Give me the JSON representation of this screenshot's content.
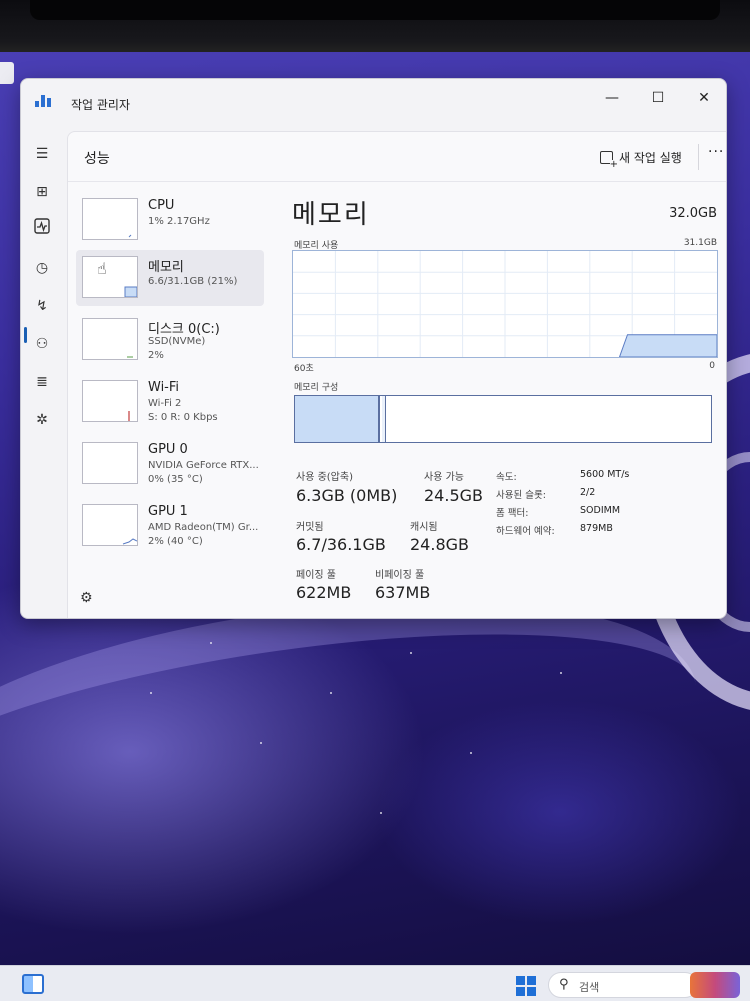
{
  "window": {
    "title": "작업 관리자",
    "minimize": "—",
    "maximize": "☐",
    "close": "✕"
  },
  "nav": {
    "icons": [
      "hamburger-icon",
      "processes-icon",
      "performance-icon",
      "app-history-icon",
      "startup-icon",
      "users-icon",
      "details-icon",
      "services-icon",
      "settings-icon"
    ],
    "active": "performance"
  },
  "header": {
    "page_title": "성능",
    "run_task_label": "새 작업 실행",
    "more": "···"
  },
  "resources": [
    {
      "name": "CPU",
      "sub1": "1% 2.17GHz",
      "sub2": ""
    },
    {
      "name": "메모리",
      "sub1": "6.6/31.1GB (21%)",
      "sub2": ""
    },
    {
      "name": "디스크 0(C:)",
      "sub1": "SSD(NVMe)",
      "sub2": "2%"
    },
    {
      "name": "Wi-Fi",
      "sub1": "Wi-Fi 2",
      "sub2": "S: 0 R: 0 Kbps"
    },
    {
      "name": "GPU 0",
      "sub1": "NVIDIA GeForce RTX...",
      "sub2": "0% (35 °C)"
    },
    {
      "name": "GPU 1",
      "sub1": "AMD Radeon(TM) Gr...",
      "sub2": "2% (40 °C)"
    }
  ],
  "memory": {
    "title": "메모리",
    "total": "32.0GB",
    "usage_label": "메모리 사용",
    "usage_max": "31.1GB",
    "graph_left": "60초",
    "graph_right": "0",
    "usage_fraction": 0.21,
    "composition_label": "메모리 구성",
    "in_use_fraction": 0.205,
    "stats": {
      "in_use_label": "사용 중(압축)",
      "in_use_value": "6.3GB (0MB)",
      "available_label": "사용 가능",
      "available_value": "24.5GB",
      "committed_label": "커밋됨",
      "committed_value": "6.7/36.1GB",
      "cached_label": "캐시됨",
      "cached_value": "24.8GB",
      "paged_label": "페이징 풀",
      "paged_value": "622MB",
      "nonpaged_label": "비페이징 풀",
      "nonpaged_value": "637MB"
    },
    "details": [
      {
        "label": "속도:",
        "value": "5600 MT/s"
      },
      {
        "label": "사용된 슬롯:",
        "value": "2/2"
      },
      {
        "label": "폼 팩터:",
        "value": "SODIMM"
      },
      {
        "label": "하드웨어 예약:",
        "value": "879MB"
      }
    ]
  },
  "taskbar": {
    "search_placeholder": "검색"
  },
  "colors": {
    "accent": "#1a5fb4",
    "graph_fill": "#c8dcf6",
    "graph_line": "#5a7cc4"
  }
}
